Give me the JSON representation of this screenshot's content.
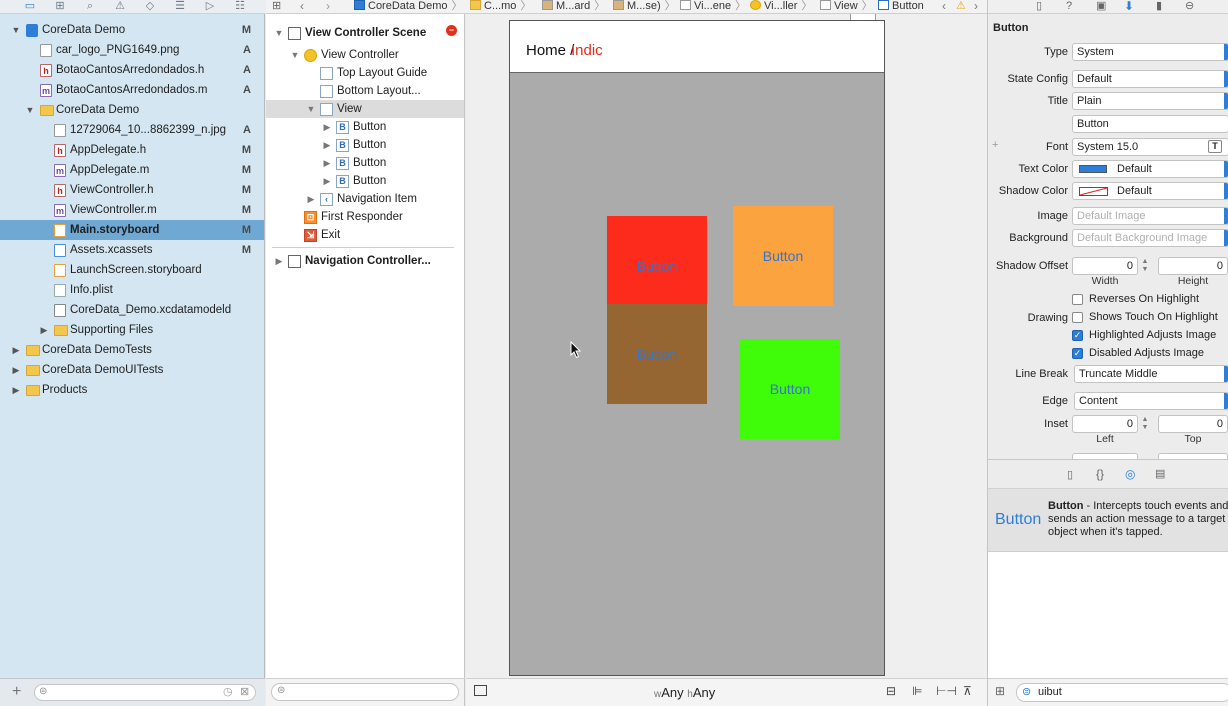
{
  "navigator": {
    "items": [
      {
        "label": "CoreData Demo",
        "status": "M",
        "icon": "project-icon"
      },
      {
        "label": "car_logo_PNG1649.png",
        "status": "A",
        "icon": "image-file-icon"
      },
      {
        "label": "BotaoCantosArredondados.h",
        "status": "A",
        "icon": "header-file-icon"
      },
      {
        "label": "BotaoCantosArredondados.m",
        "status": "A",
        "icon": "implementation-file-icon"
      },
      {
        "label": "CoreData Demo",
        "status": "",
        "icon": "folder-icon"
      },
      {
        "label": "12729064_10...8862399_n.jpg",
        "status": "A",
        "icon": "image-file-icon"
      },
      {
        "label": "AppDelegate.h",
        "status": "M",
        "icon": "header-file-icon"
      },
      {
        "label": "AppDelegate.m",
        "status": "M",
        "icon": "implementation-file-icon"
      },
      {
        "label": "ViewController.h",
        "status": "M",
        "icon": "header-file-icon"
      },
      {
        "label": "ViewController.m",
        "status": "M",
        "icon": "implementation-file-icon"
      },
      {
        "label": "Main.storyboard",
        "status": "M",
        "icon": "storyboard-file-icon"
      },
      {
        "label": "Assets.xcassets",
        "status": "M",
        "icon": "asset-catalog-icon"
      },
      {
        "label": "LaunchScreen.storyboard",
        "status": "",
        "icon": "storyboard-file-icon"
      },
      {
        "label": "Info.plist",
        "status": "",
        "icon": "plist-file-icon"
      },
      {
        "label": "CoreData_Demo.xcdatamodeld",
        "status": "",
        "icon": "data-model-icon"
      },
      {
        "label": "Supporting Files",
        "status": "",
        "icon": "folder-icon"
      },
      {
        "label": "CoreData DemoTests",
        "status": "",
        "icon": "folder-icon"
      },
      {
        "label": "CoreData DemoUITests",
        "status": "",
        "icon": "folder-icon"
      },
      {
        "label": "Products",
        "status": "",
        "icon": "folder-icon"
      }
    ],
    "selected": "Main.storyboard",
    "add_label": "+"
  },
  "jumpbar": {
    "crumbs": [
      "CoreData Demo",
      "C...mo",
      "M...ard",
      "M...se)",
      "Vi...ene",
      "Vi...ller",
      "View",
      "Button"
    ]
  },
  "outline": {
    "items": [
      {
        "label": "View Controller Scene",
        "icon": "scene-icon"
      },
      {
        "label": "View Controller",
        "icon": "view-controller-icon"
      },
      {
        "label": "Top Layout Guide",
        "icon": "layout-guide-icon"
      },
      {
        "label": "Bottom Layout...",
        "icon": "layout-guide-icon"
      },
      {
        "label": "View",
        "icon": "view-icon"
      },
      {
        "label": "Button",
        "icon": "button-icon"
      },
      {
        "label": "Button",
        "icon": "button-icon"
      },
      {
        "label": "Button",
        "icon": "button-icon"
      },
      {
        "label": "Button",
        "icon": "button-icon"
      },
      {
        "label": "Navigation Item",
        "icon": "navigation-item-icon"
      },
      {
        "label": "First Responder",
        "icon": "first-responder-icon"
      },
      {
        "label": "Exit",
        "icon": "exit-icon"
      },
      {
        "label": "Navigation Controller...",
        "icon": "scene-icon"
      }
    ],
    "button_glyph": "B"
  },
  "canvas": {
    "nav_home": "Home /",
    "nav_indic": "Indic",
    "buttons": [
      {
        "label": "Button",
        "color": "#fc2b1c"
      },
      {
        "label": "Button",
        "color": "#fba33e"
      },
      {
        "label": "Button",
        "color": "#966632"
      },
      {
        "label": "Button",
        "color": "#3ffd08"
      }
    ],
    "size_w_prefix": "w",
    "size_w": "Any",
    "size_h_prefix": "h",
    "size_h": "Any"
  },
  "inspector": {
    "section_title": "Button",
    "type_label": "Type",
    "type_value": "System",
    "state_config_label": "State Config",
    "state_config_value": "Default",
    "title_label": "Title",
    "title_value": "Plain",
    "title_text": "Button",
    "font_label": "Font",
    "font_value": "System 15.0",
    "text_color_label": "Text Color",
    "text_color_value": "Default",
    "shadow_color_label": "Shadow Color",
    "shadow_color_value": "Default",
    "image_label": "Image",
    "image_placeholder": "Default Image",
    "background_label": "Background",
    "background_placeholder": "Default Background Image",
    "shadow_offset_label": "Shadow Offset",
    "shadow_width": "0",
    "shadow_height": "0",
    "width_label": "Width",
    "height_label": "Height",
    "reverses_label": "Reverses On Highlight",
    "drawing_label": "Drawing",
    "shows_touch_label": "Shows Touch On Highlight",
    "highlighted_label": "Highlighted Adjusts Image",
    "disabled_label": "Disabled Adjusts Image",
    "line_break_label": "Line Break",
    "line_break_value": "Truncate Middle",
    "edge_label": "Edge",
    "edge_value": "Content",
    "inset_label": "Inset",
    "inset_left": "0",
    "inset_top": "0",
    "left_label": "Left",
    "top_label": "Top",
    "library_item_name": "Button",
    "library_desc_title": "Button",
    "library_desc": " - Intercepts touch events and sends an action message to a target object when it's tapped.",
    "filter_value": "uibut",
    "text_color_swatch": "#2d7ed6"
  }
}
